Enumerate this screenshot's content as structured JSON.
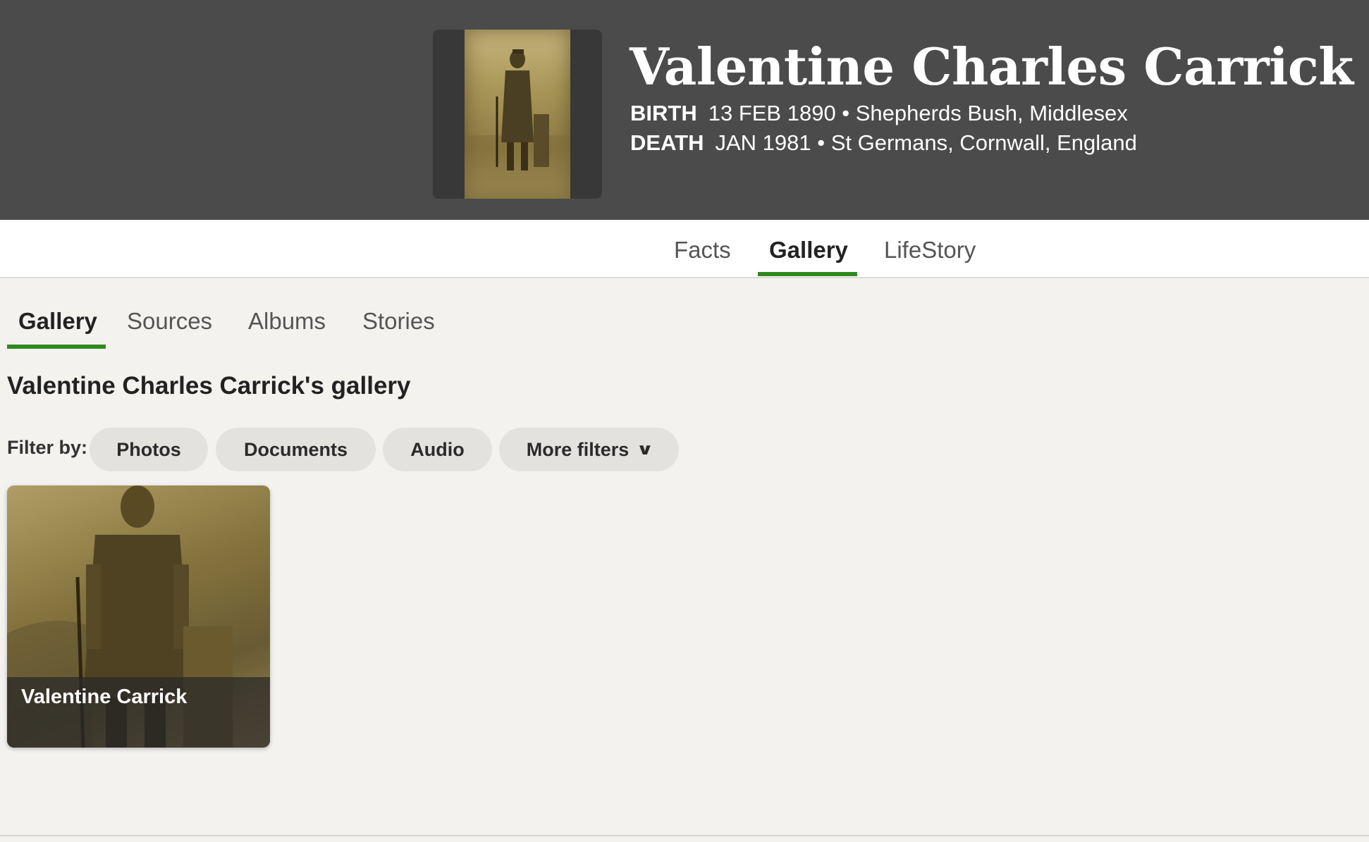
{
  "person": {
    "name": "Valentine Charles Carrick",
    "birth_label": "BIRTH",
    "birth_value": "13 FEB 1890 • Shepherds Bush, Middlesex",
    "death_label": "DEATH",
    "death_value": "JAN 1981 • St Germans, Cornwall, England"
  },
  "main_tabs": [
    {
      "label": "Facts",
      "active": false
    },
    {
      "label": "Gallery",
      "active": true
    },
    {
      "label": "LifeStory",
      "active": false
    }
  ],
  "sub_tabs": [
    {
      "label": "Gallery",
      "active": true
    },
    {
      "label": "Sources",
      "active": false
    },
    {
      "label": "Albums",
      "active": false
    },
    {
      "label": "Stories",
      "active": false
    }
  ],
  "gallery": {
    "heading": "Valentine Charles Carrick's gallery",
    "filter_label": "Filter by:",
    "filters": [
      "Photos",
      "Documents",
      "Audio"
    ],
    "more_filters_label": "More filters",
    "items": [
      {
        "title": "Valentine Carrick"
      }
    ]
  },
  "colors": {
    "hero_bg": "#4b4b4b",
    "accent_green": "#2f8a1e",
    "page_bg": "#f4f2ef",
    "chip_bg": "#e4e2df"
  },
  "icons": {
    "more_filters": "chevron-down-icon"
  }
}
